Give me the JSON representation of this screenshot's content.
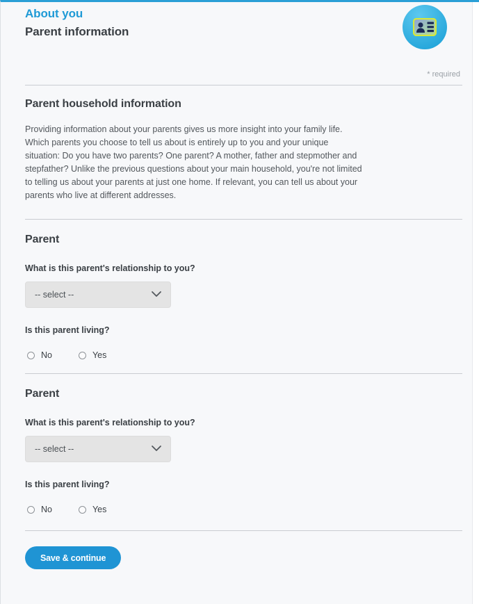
{
  "header": {
    "eyebrow": "About you",
    "title": "Parent information",
    "badge_icon": "id-card-icon",
    "required_note": "* required"
  },
  "household": {
    "heading": "Parent household information",
    "intro": "Providing information about your parents gives us more insight into your family life. Which parents you choose to tell us about is entirely up to you and your unique situation: Do you have two parents? One parent? A mother, father and stepmother and stepfather? Unlike the previous questions about your main household, you're not limited to telling us about your parents at just one home. If relevant, you can tell us about your parents who live at different addresses."
  },
  "parents": [
    {
      "heading": "Parent",
      "relationship_label": "What is this parent's relationship to you?",
      "relationship_value": "-- select --",
      "living_label": "Is this parent living?",
      "options": [
        "No",
        "Yes"
      ],
      "selected": null
    },
    {
      "heading": "Parent",
      "relationship_label": "What is this parent's relationship to you?",
      "relationship_value": "-- select --",
      "living_label": "Is this parent living?",
      "options": [
        "No",
        "Yes"
      ],
      "selected": null
    }
  ],
  "footer": {
    "submit_label": "Save & continue"
  },
  "colors": {
    "accent_blue": "#1f9ad6",
    "button_blue": "#1f94d4",
    "text_dark": "#3a3f44",
    "text_body": "#52575c",
    "muted": "#9aa0a6",
    "select_bg": "#e4e4e4",
    "page_bg": "#f7f8fa"
  }
}
